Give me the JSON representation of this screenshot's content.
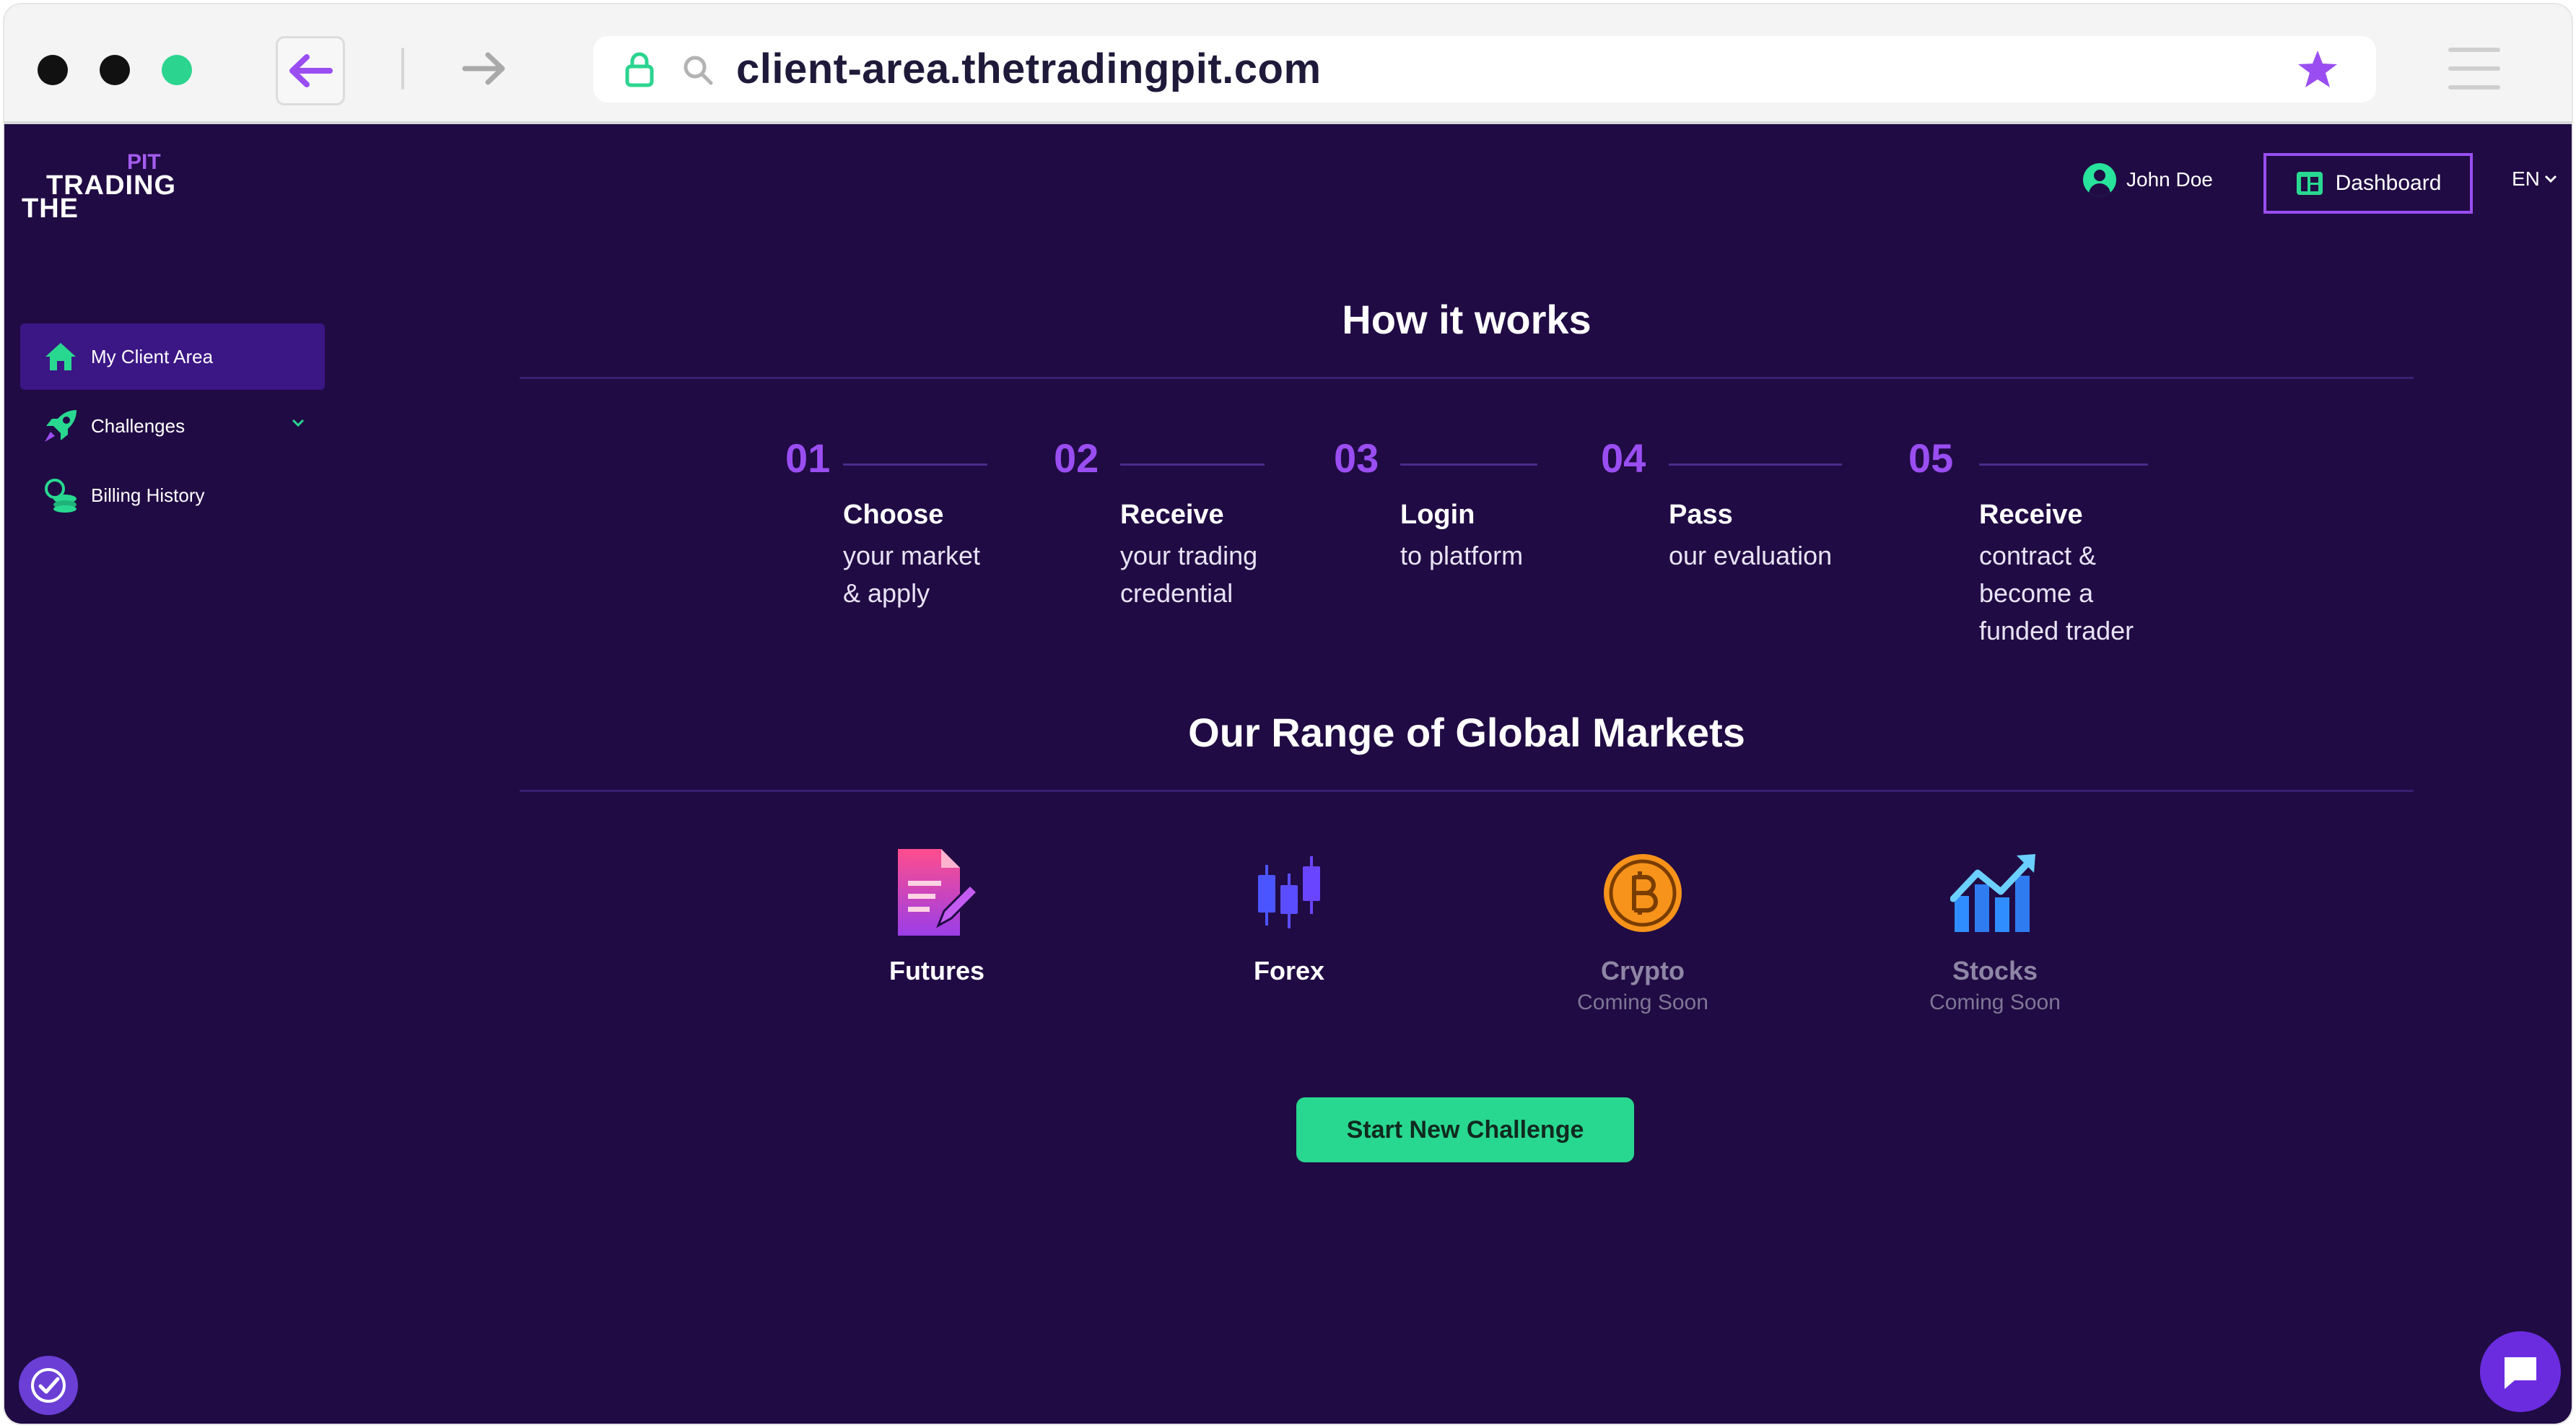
{
  "browser": {
    "url": "client-area.thetradingpit.com",
    "icons": [
      "back-arrow-icon",
      "forward-arrow-icon",
      "lock-icon",
      "search-icon",
      "star-icon",
      "menu-icon"
    ]
  },
  "brand": {
    "line1": "PIT",
    "line2": "TRADING",
    "line3": "THE"
  },
  "header": {
    "user_name": "John Doe",
    "dashboard_label": "Dashboard",
    "language": "EN"
  },
  "sidebar": {
    "items": [
      {
        "label": "My Client Area",
        "icon": "home-icon",
        "active": true
      },
      {
        "label": "Challenges",
        "icon": "rocket-icon"
      },
      {
        "label": "Billing History",
        "icon": "coins-icon"
      }
    ]
  },
  "how_it_works": {
    "title": "How it works",
    "steps": [
      {
        "number": "01",
        "title": "Choose",
        "line1": "your market",
        "line2": "& apply"
      },
      {
        "number": "02",
        "title": "Receive",
        "line1": "your trading",
        "line2": "credential"
      },
      {
        "number": "03",
        "title": "Login",
        "line1": "to platform"
      },
      {
        "number": "04",
        "title": "Pass",
        "line1": "our evaluation"
      },
      {
        "number": "05",
        "title": "Receive",
        "line1": "contract &",
        "line2": "become a",
        "line3": "funded trader"
      }
    ]
  },
  "markets": {
    "title": "Our Range of Global Markets",
    "items": [
      {
        "name": "Futures",
        "icon": "futures-document-icon"
      },
      {
        "name": "Forex",
        "icon": "candlestick-icon"
      },
      {
        "name": "Crypto",
        "status": "Coming Soon",
        "icon": "bitcoin-icon"
      },
      {
        "name": "Stocks",
        "status": "Coming Soon",
        "icon": "stock-chart-icon"
      }
    ]
  },
  "cta": {
    "label": "Start New Challenge"
  },
  "colors": {
    "background": "#200b44",
    "accent_purple": "#9a4ef2",
    "accent_green": "#29d890"
  }
}
